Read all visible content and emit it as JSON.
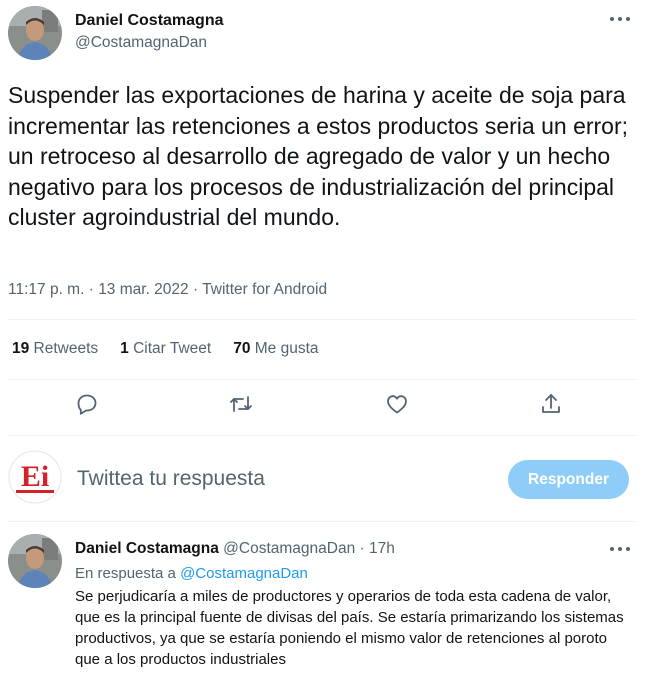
{
  "tweet": {
    "author_name": "Daniel Costamagna",
    "author_handle": "@CostamagnaDan",
    "avatar_icon": "profile-photo",
    "more_icon": "more-icon",
    "text": "Suspender las exportaciones de harina y aceite de soja para incrementar las retenciones a estos productos seria un error; un retroceso al desarrollo de agregado de valor y un hecho negativo para los procesos de industrialización del principal cluster agroindustrial del mundo.",
    "time": "11:17 p. m.",
    "date": "13 mar. 2022",
    "source": "Twitter for Android",
    "separator": " · "
  },
  "stats": {
    "retweets_count": "19",
    "retweets_label": " Retweets",
    "quotes_count": "1",
    "quotes_label": " Citar Tweet",
    "likes_count": "70",
    "likes_label": " Me gusta"
  },
  "actions": [
    "reply-icon",
    "retweet-icon",
    "like-icon",
    "share-icon"
  ],
  "reply_box": {
    "logo_text": "Ei",
    "placeholder": "Twittea tu respuesta",
    "button_label": "Responder",
    "button_color": "#8ecdf8"
  },
  "reply_tweet": {
    "author_name": "Daniel Costamagna",
    "author_handle": "@CostamagnaDan",
    "time": "17h",
    "replying_prefix": "En respuesta a ",
    "replying_handle": "@CostamagnaDan",
    "text": "Se perjudicaría a miles de productores y operarios de toda esta cadena de valor, que es la principal fuente de divisas del país. Se estaría primarizando los sistemas productivos, ya que se estaría poniendo el mismo valor de retenciones al poroto que a los productos industriales"
  },
  "colors": {
    "text_primary": "#0f1419",
    "text_secondary": "#536471",
    "accent": "#1d9bf0",
    "divider": "#eff3f4",
    "logo_red": "#d32228"
  }
}
